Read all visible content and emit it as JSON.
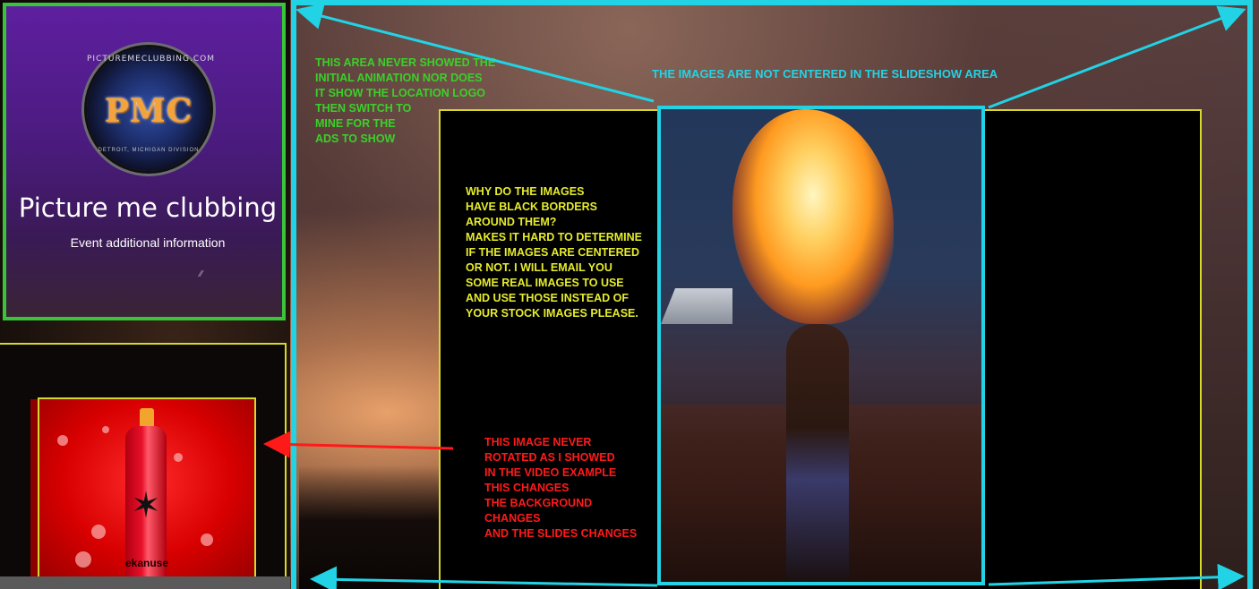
{
  "logo": {
    "ring_text": "PICTUREMECLUBBING.COM",
    "letters": "PMC",
    "bottom_text": "DETROIT, MICHIGAN DIVISION"
  },
  "event": {
    "title": "Picture me clubbing",
    "info": "Event additional information"
  },
  "ad": {
    "brand": "ekanuse"
  },
  "annotations": {
    "green": "THIS AREA NEVER SHOWED THE\nINITIAL ANIMATION NOR DOES\nIT SHOW THE LOCATION LOGO\nTHEN SWITCH TO\nMINE FOR THE\nADS TO SHOW",
    "cyan": "THE IMAGES ARE NOT CENTERED IN THE SLIDESHOW AREA",
    "yellow": "WHY DO THE IMAGES\nHAVE BLACK BORDERS\nAROUND THEM?\nMAKES IT HARD TO DETERMINE\nIF THE IMAGES ARE CENTERED\nOR NOT. I WILL EMAIL YOU\nSOME REAL IMAGES TO USE\nAND USE THOSE INSTEAD OF\nYOUR STOCK IMAGES PLEASE.",
    "red": "THIS IMAGE NEVER\nROTATED  AS I SHOWED\nIN THE VIDEO EXAMPLE\nTHIS CHANGES\nTHE BACKGROUND\nCHANGES\nAND THE SLIDES CHANGES"
  },
  "colors": {
    "frame_cyan": "#22d3e6",
    "frame_green": "#3ac43a",
    "frame_yellow": "#d6d82a",
    "arrow_red": "#ff1a1a"
  }
}
